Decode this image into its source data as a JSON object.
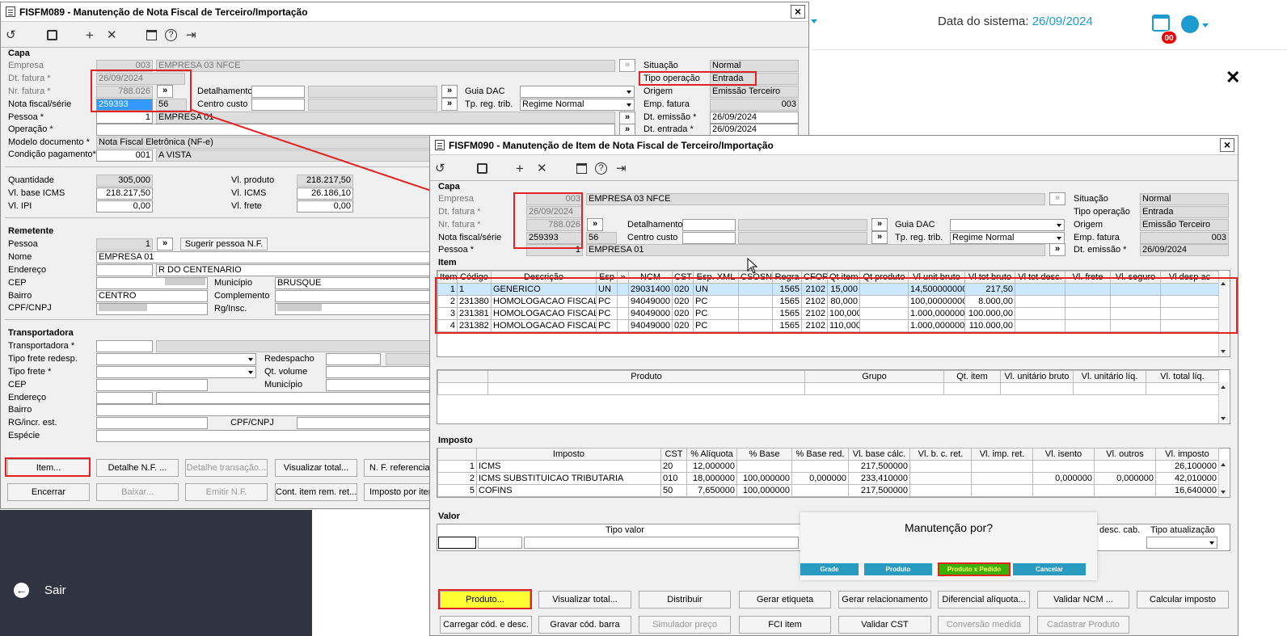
{
  "header": {
    "system_date_label": "Data do sistema:",
    "system_date_value": "26/09/2024",
    "notif_badge": "00",
    "close_x": "✕"
  },
  "sidebar": {
    "sair": "Sair"
  },
  "win1": {
    "title": "FISFM089 - Manutenção de Nota Fiscal de Terceiro/Importação",
    "capa": "Capa",
    "labels": {
      "empresa": "Empresa",
      "dt_fatura": "Dt. fatura *",
      "nr_fatura": "Nr. fatura *",
      "nota_serie": "Nota fiscal/série",
      "pessoa": "Pessoa *",
      "operacao": "Operação *",
      "modelo": "Modelo documento *",
      "cond_pag": "Condição pagamento*",
      "detalhamento": "Detalhamento",
      "centro_custo": "Centro custo",
      "guia_dac": "Guia DAC",
      "tp_reg_trib": "Tp. reg. trib.",
      "situacao": "Situação",
      "tipo_op": "Tipo operação",
      "origem": "Origem",
      "emp_fatura": "Emp. fatura",
      "dt_emissao": "Dt. emissão *",
      "dt_entrada": "Dt. entrada *",
      "quantidade": "Quantidade",
      "vl_base_icms": "Vl. base ICMS",
      "vl_ipi": "Vl. IPI",
      "vl_produto": "Vl. produto",
      "vl_icms": "Vl. ICMS",
      "vl_frete": "Vl. frete"
    },
    "values": {
      "empresa_code": "003",
      "empresa_name": "EMPRESA 03 NFCE",
      "dt_fatura": "26/09/2024",
      "nr_fatura": "788.026",
      "nota": "259393",
      "serie": "56",
      "pessoa_code": "1",
      "pessoa_name": "EMPRESA 01",
      "modelo": "Nota Fiscal Eletrônica (NF-e)",
      "cond_code": "001",
      "cond_name": "A VISTA",
      "tp_reg_trib": "Regime Normal",
      "situacao": "Normal",
      "tipo_op": "Entrada",
      "origem": "Emissão Terceiro",
      "emp_fatura": "003",
      "dt_emissao": "26/09/2024",
      "dt_entrada": "26/09/2024",
      "quantidade": "305,000",
      "vl_base_icms": "218.217,50",
      "vl_ipi": "0,00",
      "vl_produto": "218.217,50",
      "vl_icms": "26.186,10",
      "vl_frete": "0,00"
    },
    "remetente": {
      "title": "Remetente",
      "labels": {
        "pessoa": "Pessoa",
        "nome": "Nome",
        "endereco": "Endereço",
        "cep": "CEP",
        "bairro": "Bairro",
        "cpf": "CPF/CNPJ",
        "municipio": "Município",
        "complemento": "Complemento",
        "rg": "Rg/Insc."
      },
      "pessoa": "1",
      "sugerir": "Sugerir pessoa N.F.",
      "nome": "EMPRESA 01",
      "endereco": "R DO CENTENARIO",
      "municipio": "BRUSQUE",
      "bairro": "CENTRO"
    },
    "transportadora": {
      "title": "Transportadora",
      "labels": {
        "transp": "Transportadora *",
        "tipo_frete_redesp": "Tipo frete redesp.",
        "tipo_frete": "Tipo frete *",
        "cep": "CEP",
        "endereco": "Endereço",
        "bairro": "Bairro",
        "rg": "RG/incr. est.",
        "especie": "Espécie",
        "redespacho": "Redespacho",
        "qt_volume": "Qt. volume",
        "municipio": "Município",
        "cpf": "CPF/CNPJ"
      }
    },
    "buttons": [
      "Item...",
      "Detalhe N.F. ...",
      "Detalhe transação...",
      "Visualizar total...",
      "N. F. referencia",
      "Encerrar",
      "Baixar...",
      "Emitir N.F.",
      "Cont. item rem. ret...",
      "Imposto por item"
    ]
  },
  "win2": {
    "title": "FISFM090 - Manutenção de Item de Nota Fiscal de Terceiro/Importação",
    "capa": "Capa",
    "item_section": "Item",
    "labels": {
      "empresa": "Empresa",
      "dt_fatura": "Dt. fatura *",
      "nr_fatura": "Nr. fatura *",
      "nota_serie": "Nota fiscal/série",
      "pessoa": "Pessoa *",
      "detalhamento": "Detalhamento",
      "centro_custo": "Centro custo",
      "guia_dac": "Guia DAC",
      "tp_reg_trib": "Tp. reg. trib.",
      "situacao": "Situação",
      "tipo_op": "Tipo operação",
      "origem": "Origem",
      "emp_fatura": "Emp. fatura",
      "dt_emissao": "Dt. emissão *"
    },
    "values": {
      "empresa_code": "003",
      "empresa_name": "EMPRESA 03 NFCE",
      "dt_fatura": "26/09/2024",
      "nr_fatura": "788.026",
      "nota": "259393",
      "serie": "56",
      "pessoa_code": "1",
      "pessoa_name": "EMPRESA 01",
      "tp_reg_trib": "Regime Normal",
      "situacao": "Normal",
      "tipo_op": "Entrada",
      "origem": "Emissão Terceiro",
      "emp_fatura": "003",
      "dt_emissao": "26/09/2024"
    },
    "items_cols": [
      "Item",
      "Código",
      "Descrição",
      "Esp",
      "»",
      "NCM",
      "CST",
      "Esp. XML",
      "CSOSN",
      "Regra",
      "CFOP",
      "Qt item",
      "Qt produto",
      "Vl unit bruto",
      "Vl tot bruto",
      "Vl tot desc.",
      "Vl. frete",
      "Vl. seguro",
      "Vl desp ac"
    ],
    "items": [
      [
        "1",
        "1",
        "GENERICO",
        "UN",
        "",
        "29031400",
        "020",
        "UN",
        "",
        "1565",
        "2102",
        "15,000",
        "",
        "14,500000000",
        "217,50",
        "",
        "",
        "",
        ""
      ],
      [
        "2",
        "231380",
        "HOMOLOGACAO FISCAL U",
        "PC",
        "",
        "94049000",
        "020",
        "PC",
        "",
        "1565",
        "2102",
        "80,000",
        "",
        "100,000000000",
        "8.000,00",
        "",
        "",
        "",
        ""
      ],
      [
        "3",
        "231381",
        "HOMOLOGACAO FISCAL U",
        "PC",
        "",
        "94049000",
        "020",
        "PC",
        "",
        "1565",
        "2102",
        "100,000",
        "",
        "1.000,000000",
        "100.000,00",
        "",
        "",
        "",
        ""
      ],
      [
        "4",
        "231382",
        "HOMOLOGACAO FISCAL U",
        "PC",
        "",
        "94049000",
        "020",
        "PC",
        "",
        "1565",
        "2102",
        "110,000",
        "",
        "1.000,000000",
        "110.000,00",
        "",
        "",
        "",
        ""
      ]
    ],
    "prod_cols": [
      "Produto",
      "Grupo",
      "Qt. item",
      "Vl. unitário bruto",
      "Vl. unitário líq.",
      "Vl. total líq."
    ],
    "imposto_section": "Imposto",
    "imp_cols": [
      "Imposto",
      "CST",
      "% Alíquota",
      "% Base",
      "% Base red.",
      "Vl. base cálc.",
      "Vl. b. c. ret.",
      "Vl. imp. ret.",
      "Vl. isento",
      "Vl. outros",
      "Vl. imposto"
    ],
    "imp_rows": [
      [
        "1",
        "ICMS",
        "20",
        "12,000000",
        "",
        "",
        "217,500000",
        "",
        "",
        "",
        "",
        "26,100000"
      ],
      [
        "2",
        "ICMS SUBSTITUICAO TRIBUTARIA",
        "010",
        "18,000000",
        "100,000000",
        "0,000000",
        "233,410000",
        "",
        "",
        "0,000000",
        "0,000000",
        "42,010000"
      ],
      [
        "5",
        "COFINS",
        "50",
        "7,650000",
        "100,000000",
        "",
        "217,500000",
        "",
        "",
        "",
        "",
        "16,640000"
      ]
    ],
    "valor_section": "Valor",
    "valor_cols": {
      "tipo_valor": "Tipo valor",
      "desc_cab": "desc. cab.",
      "tipo_atual": "Tipo atualização"
    },
    "buttons_row1": [
      "Produto...",
      "Visualizar total...",
      "Distribuir",
      "Gerar etiqueta",
      "Gerar relacionamento",
      "Diferencial alíquota...",
      "Validar NCM ...",
      "Calcular imposto"
    ],
    "buttons_row2": [
      "Carregar cód. e desc.",
      "Gravar cód. barra",
      "Simulador preço",
      "FCI item",
      "Validar CST",
      "Conversão medida",
      "Cadastrar Produto"
    ]
  },
  "popup": {
    "title": "Manutenção por?",
    "buttons": [
      "Grade",
      "Produto",
      "Produto x Pedido",
      "Cancelar"
    ]
  },
  "colors": {
    "accent": "#1d9bd1",
    "red_highlight": "#e32222",
    "yellow_highlight": "#ffff33",
    "sidebar": "#2f3440"
  }
}
